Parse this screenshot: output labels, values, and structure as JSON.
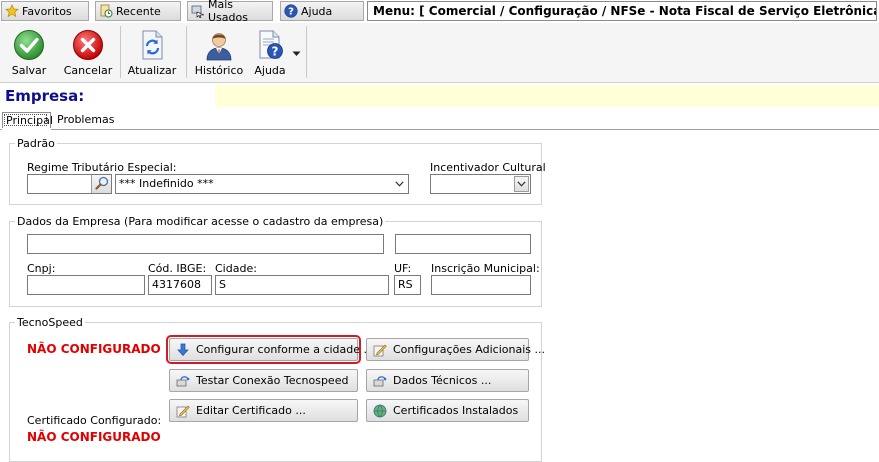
{
  "nav": {
    "favoritos": "Favoritos",
    "recente": "Recente",
    "mais_usados": "Mais Usados",
    "ajuda": "Ajuda",
    "menu_path": "Menu: [ Comercial / Configuração / NFSe - Nota Fiscal de Serviço Eletrônica]"
  },
  "toolbar": {
    "salvar": "Salvar",
    "cancelar": "Cancelar",
    "atualizar": "Atualizar",
    "historico": "Histórico",
    "ajuda": "Ajuda"
  },
  "empresa": {
    "label": "Empresa:",
    "value": ""
  },
  "tabs": [
    "Principal",
    "Problemas"
  ],
  "padrao": {
    "title": "Padrão",
    "regime_label": "Regime Tributário Especial:",
    "regime_code": "",
    "regime_value": "*** Indefinido ***",
    "incentivador_label": "Incentivador Cultural",
    "incentivador_value": ""
  },
  "dados_empresa": {
    "title": "Dados da Empresa (Para modificar acesse o cadastro da empresa)",
    "nome": "",
    "extra": "",
    "cnpj_label": "Cnpj:",
    "cnpj": "",
    "ibge_label": "Cód. IBGE:",
    "ibge": "4317608",
    "cidade_label": "Cidade:",
    "cidade": "S",
    "uf_label": "UF:",
    "uf": "RS",
    "im_label": "Inscrição Municipal:",
    "im": ""
  },
  "tecnospeed": {
    "title": "TecnoSpeed",
    "status": "NÃO CONFIGURADO",
    "btn_configurar": "Configurar conforme a cidade ...",
    "btn_config_adicionais": "Configurações Adicionais ...",
    "btn_testar": "Testar Conexão Tecnospeed",
    "btn_dados_tecnicos": "Dados Técnicos ...",
    "btn_editar_cert": "Editar Certificado ...",
    "btn_certs_instalados": "Certificados Instalados",
    "cert_label": "Certificado Configurado:",
    "cert_status": "NÃO CONFIGURADO"
  },
  "colors": {
    "accent_title": "#0f0f8c",
    "empresa_bg": "#ffffd8",
    "alert": "#e00000",
    "highlight_border": "#d01c24"
  }
}
